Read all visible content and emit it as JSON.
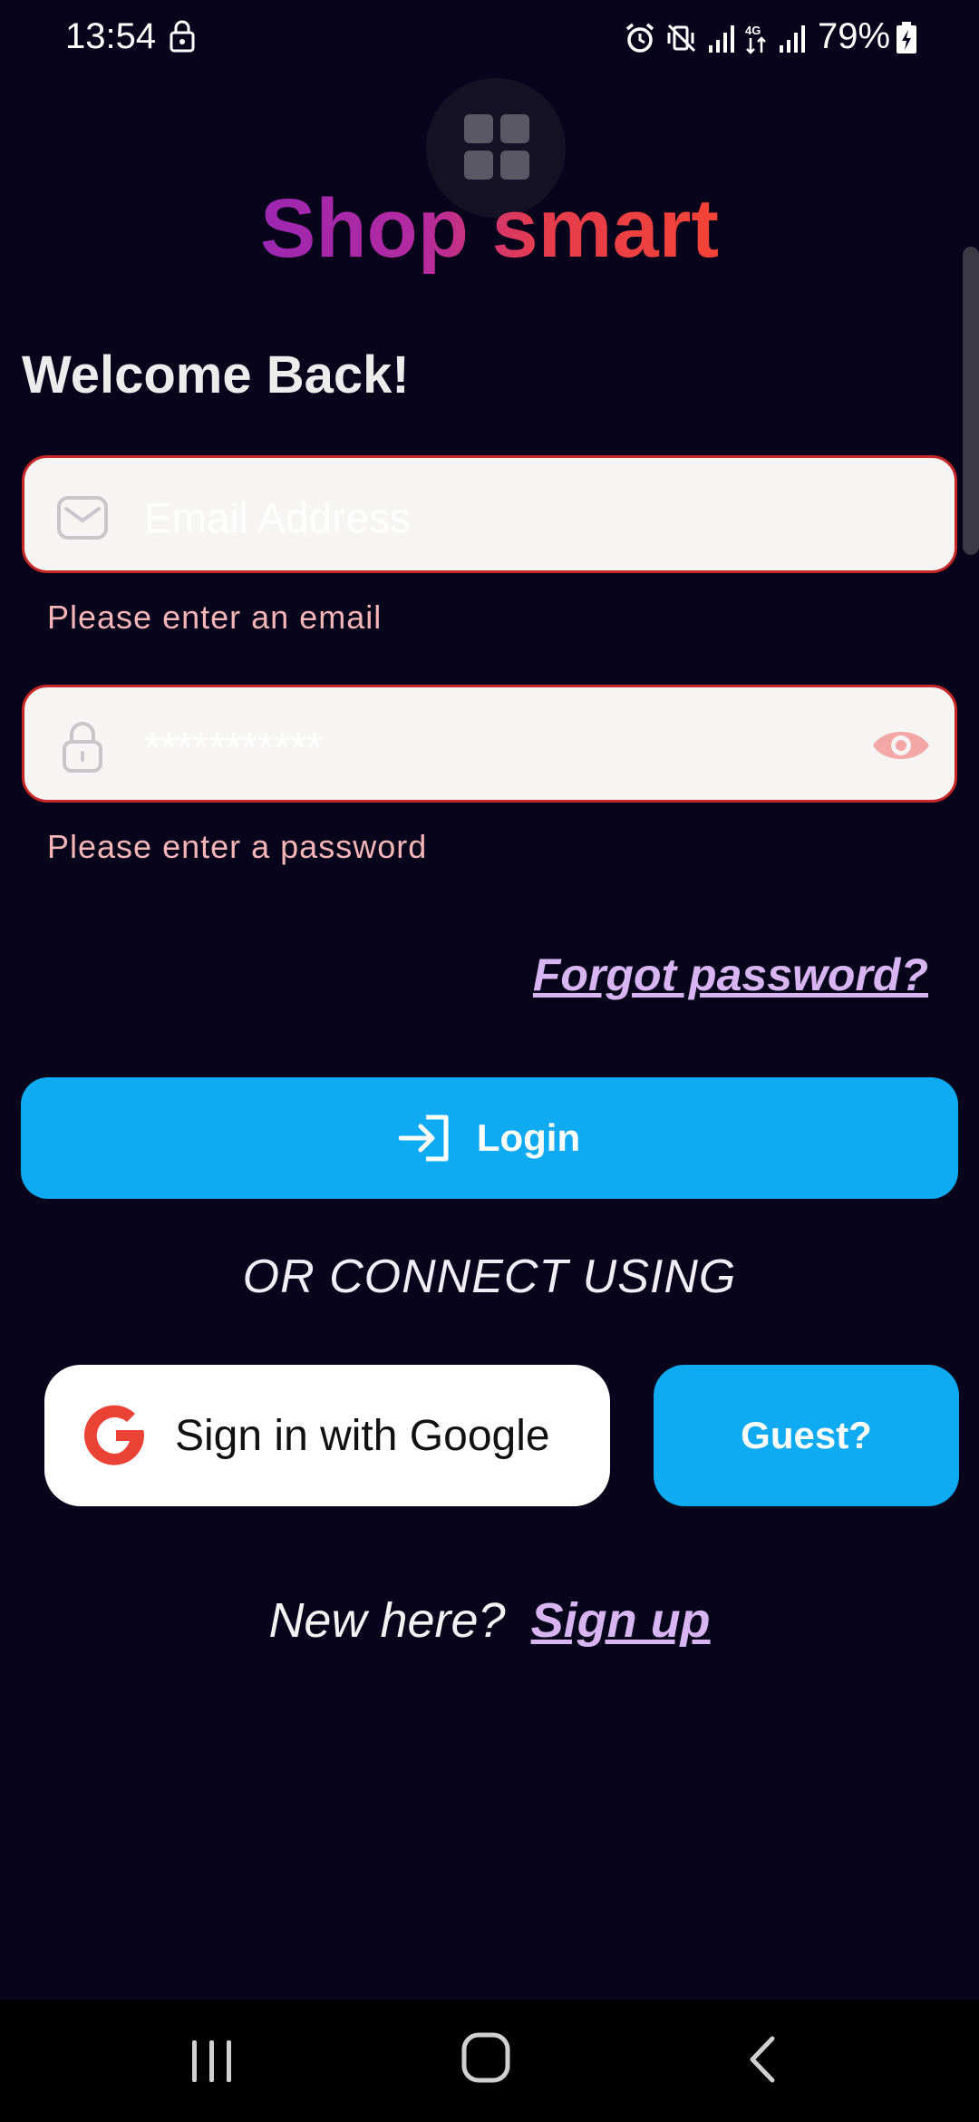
{
  "status_bar": {
    "time": "13:54",
    "battery": "79%",
    "icons": [
      "lock-icon",
      "alarm-icon",
      "vibrate-icon",
      "signal-icon",
      "4g-icon",
      "signal-icon"
    ]
  },
  "brand": {
    "title": "Shop smart"
  },
  "welcome": "Welcome Back!",
  "email": {
    "placeholder": "Email Address",
    "error": "Please enter an email"
  },
  "password": {
    "placeholder": "***********",
    "error": "Please enter a password"
  },
  "forgot_password": "Forgot password?",
  "login_button": "Login",
  "or_connect": "OR CONNECT USING",
  "google_button": "Sign in with Google",
  "guest_button": "Guest?",
  "signup": {
    "prompt": "New here?",
    "link": "Sign up"
  },
  "colors": {
    "background": "#08041c",
    "primary_button": "#0eaaf2",
    "error": "#c62828",
    "link": "#d7b5f0",
    "brand_start": "#9c27b0",
    "brand_end": "#f44336"
  }
}
